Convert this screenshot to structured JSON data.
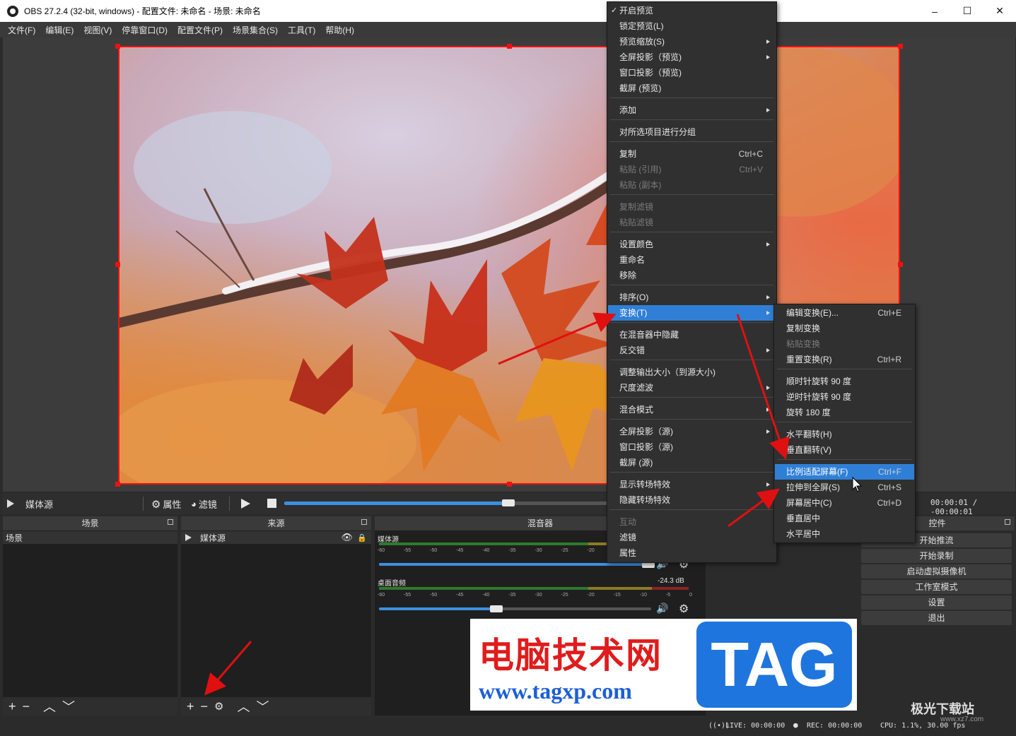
{
  "window": {
    "title": "OBS 27.2.4 (32-bit, windows) - 配置文件: 未命名 - 场景: 未命名",
    "minimize": "–",
    "maximize": "☐",
    "close": "✕"
  },
  "menubar": [
    "文件(F)",
    "编辑(E)",
    "视图(V)",
    "停靠窗口(D)",
    "配置文件(P)",
    "场景集合(S)",
    "工具(T)",
    "帮助(H)"
  ],
  "sourcebar": {
    "source_name": "媒体源",
    "properties": "属性",
    "filters": "滤镜",
    "timecode": "00:00:01 / -00:00:01",
    "progress": 0.69
  },
  "docks": {
    "scenes": {
      "title": "场景",
      "items": [
        "场景"
      ]
    },
    "sources": {
      "title": "来源",
      "items": [
        "媒体源"
      ]
    },
    "mixer": {
      "title": "混音器",
      "channels": [
        {
          "name": "媒体源",
          "db": "",
          "volume": 0.99
        },
        {
          "name": "桌面音频",
          "db": "-24.3 dB",
          "volume": 0.43
        }
      ],
      "ticks": [
        "-60",
        "-55",
        "-50",
        "-45",
        "-40",
        "-35",
        "-30",
        "-25",
        "-20",
        "-15",
        "-10",
        "-5",
        "0"
      ]
    },
    "controls": {
      "title": "控件",
      "buttons": [
        "开始推流",
        "开始录制",
        "启动虚拟摄像机",
        "工作室模式",
        "设置",
        "退出"
      ]
    }
  },
  "statusbar": {
    "live": "LIVE: 00:00:00",
    "rec": "REC: 00:00:00",
    "cpu": "CPU: 1.1%, 30.00 fps"
  },
  "context_menu": {
    "items": [
      {
        "label": "开启预览",
        "checked": true
      },
      {
        "label": "锁定预览(L)"
      },
      {
        "label": "预览缩放(S)",
        "submenu": true
      },
      {
        "label": "全屏投影（预览)",
        "submenu": true
      },
      {
        "label": "窗口投影（预览)"
      },
      {
        "label": "截屏 (预览)"
      },
      {
        "label": "添加",
        "submenu": true
      },
      {
        "label": "对所选项目进行分组"
      },
      {
        "label": "复制",
        "shortcut": "Ctrl+C"
      },
      {
        "label": "粘贴 (引用)",
        "shortcut": "Ctrl+V",
        "disabled": true
      },
      {
        "label": "粘贴 (副本)",
        "disabled": true
      },
      {
        "label": "复制滤镜",
        "disabled": true
      },
      {
        "label": "粘贴滤镜",
        "disabled": true
      },
      {
        "label": "设置颜色",
        "submenu": true
      },
      {
        "label": "重命名"
      },
      {
        "label": "移除"
      },
      {
        "label": "排序(O)",
        "submenu": true
      },
      {
        "label": "变换(T)",
        "submenu": true,
        "highlighted": true
      },
      {
        "label": "在混音器中隐藏"
      },
      {
        "label": "反交错",
        "submenu": true
      },
      {
        "label": "调整输出大小（到源大小)"
      },
      {
        "label": "尺度滤波",
        "submenu": true
      },
      {
        "label": "混合模式",
        "submenu": true
      },
      {
        "label": "全屏投影（源)",
        "submenu": true
      },
      {
        "label": "窗口投影（源)"
      },
      {
        "label": "截屏 (源)"
      },
      {
        "label": "显示转场特效",
        "submenu": true
      },
      {
        "label": "隐藏转场特效",
        "submenu": true
      },
      {
        "label": "互动",
        "disabled": true
      },
      {
        "label": "滤镜"
      },
      {
        "label": "属性"
      }
    ]
  },
  "transform_submenu": {
    "items": [
      {
        "label": "编辑变换(E)...",
        "shortcut": "Ctrl+E"
      },
      {
        "label": "复制变换"
      },
      {
        "label": "粘贴变换",
        "disabled": true
      },
      {
        "label": "重置变换(R)",
        "shortcut": "Ctrl+R"
      },
      {
        "label": "顺时针旋转 90 度"
      },
      {
        "label": "逆时针旋转 90 度"
      },
      {
        "label": "旋转 180 度"
      },
      {
        "label": "水平翻转(H)"
      },
      {
        "label": "垂直翻转(V)"
      },
      {
        "label": "比例适配屏幕(F)",
        "shortcut": "Ctrl+F",
        "highlighted": true
      },
      {
        "label": "拉伸到全屏(S)",
        "shortcut": "Ctrl+S"
      },
      {
        "label": "屏幕居中(C)",
        "shortcut": "Ctrl+D"
      },
      {
        "label": "垂直居中"
      },
      {
        "label": "水平居中"
      }
    ]
  },
  "watermark": {
    "site_cn": "电脑技术网",
    "site_url": "www.tagxp.com",
    "tag": "TAG",
    "corner": "极光下载站",
    "corner_url": "www.xz7.com"
  },
  "colors": {
    "accent": "#2f7fd6",
    "selection": "#ee1111",
    "annotation_arrow": "#e01010"
  }
}
